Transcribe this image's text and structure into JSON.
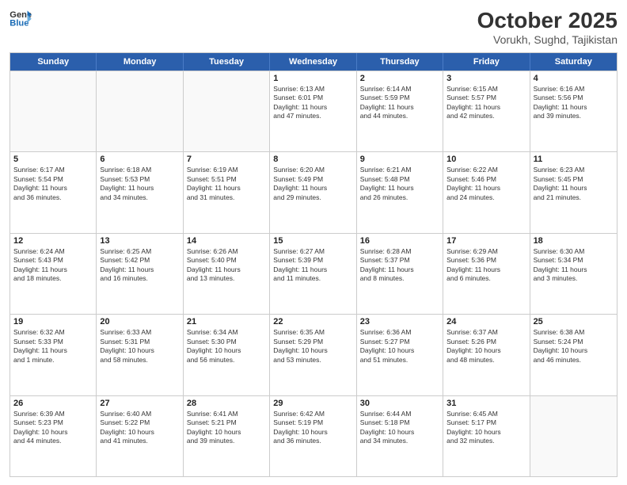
{
  "header": {
    "logo_line1": "General",
    "logo_line2": "Blue",
    "month": "October 2025",
    "location": "Vorukh, Sughd, Tajikistan"
  },
  "days_of_week": [
    "Sunday",
    "Monday",
    "Tuesday",
    "Wednesday",
    "Thursday",
    "Friday",
    "Saturday"
  ],
  "rows": [
    [
      {
        "day": "",
        "empty": true
      },
      {
        "day": "",
        "empty": true
      },
      {
        "day": "",
        "empty": true
      },
      {
        "day": "1",
        "info": "Sunrise: 6:13 AM\nSunset: 6:01 PM\nDaylight: 11 hours\nand 47 minutes."
      },
      {
        "day": "2",
        "info": "Sunrise: 6:14 AM\nSunset: 5:59 PM\nDaylight: 11 hours\nand 44 minutes."
      },
      {
        "day": "3",
        "info": "Sunrise: 6:15 AM\nSunset: 5:57 PM\nDaylight: 11 hours\nand 42 minutes."
      },
      {
        "day": "4",
        "info": "Sunrise: 6:16 AM\nSunset: 5:56 PM\nDaylight: 11 hours\nand 39 minutes."
      }
    ],
    [
      {
        "day": "5",
        "info": "Sunrise: 6:17 AM\nSunset: 5:54 PM\nDaylight: 11 hours\nand 36 minutes."
      },
      {
        "day": "6",
        "info": "Sunrise: 6:18 AM\nSunset: 5:53 PM\nDaylight: 11 hours\nand 34 minutes."
      },
      {
        "day": "7",
        "info": "Sunrise: 6:19 AM\nSunset: 5:51 PM\nDaylight: 11 hours\nand 31 minutes."
      },
      {
        "day": "8",
        "info": "Sunrise: 6:20 AM\nSunset: 5:49 PM\nDaylight: 11 hours\nand 29 minutes."
      },
      {
        "day": "9",
        "info": "Sunrise: 6:21 AM\nSunset: 5:48 PM\nDaylight: 11 hours\nand 26 minutes."
      },
      {
        "day": "10",
        "info": "Sunrise: 6:22 AM\nSunset: 5:46 PM\nDaylight: 11 hours\nand 24 minutes."
      },
      {
        "day": "11",
        "info": "Sunrise: 6:23 AM\nSunset: 5:45 PM\nDaylight: 11 hours\nand 21 minutes."
      }
    ],
    [
      {
        "day": "12",
        "info": "Sunrise: 6:24 AM\nSunset: 5:43 PM\nDaylight: 11 hours\nand 18 minutes."
      },
      {
        "day": "13",
        "info": "Sunrise: 6:25 AM\nSunset: 5:42 PM\nDaylight: 11 hours\nand 16 minutes."
      },
      {
        "day": "14",
        "info": "Sunrise: 6:26 AM\nSunset: 5:40 PM\nDaylight: 11 hours\nand 13 minutes."
      },
      {
        "day": "15",
        "info": "Sunrise: 6:27 AM\nSunset: 5:39 PM\nDaylight: 11 hours\nand 11 minutes."
      },
      {
        "day": "16",
        "info": "Sunrise: 6:28 AM\nSunset: 5:37 PM\nDaylight: 11 hours\nand 8 minutes."
      },
      {
        "day": "17",
        "info": "Sunrise: 6:29 AM\nSunset: 5:36 PM\nDaylight: 11 hours\nand 6 minutes."
      },
      {
        "day": "18",
        "info": "Sunrise: 6:30 AM\nSunset: 5:34 PM\nDaylight: 11 hours\nand 3 minutes."
      }
    ],
    [
      {
        "day": "19",
        "info": "Sunrise: 6:32 AM\nSunset: 5:33 PM\nDaylight: 11 hours\nand 1 minute."
      },
      {
        "day": "20",
        "info": "Sunrise: 6:33 AM\nSunset: 5:31 PM\nDaylight: 10 hours\nand 58 minutes."
      },
      {
        "day": "21",
        "info": "Sunrise: 6:34 AM\nSunset: 5:30 PM\nDaylight: 10 hours\nand 56 minutes."
      },
      {
        "day": "22",
        "info": "Sunrise: 6:35 AM\nSunset: 5:29 PM\nDaylight: 10 hours\nand 53 minutes."
      },
      {
        "day": "23",
        "info": "Sunrise: 6:36 AM\nSunset: 5:27 PM\nDaylight: 10 hours\nand 51 minutes."
      },
      {
        "day": "24",
        "info": "Sunrise: 6:37 AM\nSunset: 5:26 PM\nDaylight: 10 hours\nand 48 minutes."
      },
      {
        "day": "25",
        "info": "Sunrise: 6:38 AM\nSunset: 5:24 PM\nDaylight: 10 hours\nand 46 minutes."
      }
    ],
    [
      {
        "day": "26",
        "info": "Sunrise: 6:39 AM\nSunset: 5:23 PM\nDaylight: 10 hours\nand 44 minutes."
      },
      {
        "day": "27",
        "info": "Sunrise: 6:40 AM\nSunset: 5:22 PM\nDaylight: 10 hours\nand 41 minutes."
      },
      {
        "day": "28",
        "info": "Sunrise: 6:41 AM\nSunset: 5:21 PM\nDaylight: 10 hours\nand 39 minutes."
      },
      {
        "day": "29",
        "info": "Sunrise: 6:42 AM\nSunset: 5:19 PM\nDaylight: 10 hours\nand 36 minutes."
      },
      {
        "day": "30",
        "info": "Sunrise: 6:44 AM\nSunset: 5:18 PM\nDaylight: 10 hours\nand 34 minutes."
      },
      {
        "day": "31",
        "info": "Sunrise: 6:45 AM\nSunset: 5:17 PM\nDaylight: 10 hours\nand 32 minutes."
      },
      {
        "day": "",
        "empty": true
      }
    ]
  ]
}
